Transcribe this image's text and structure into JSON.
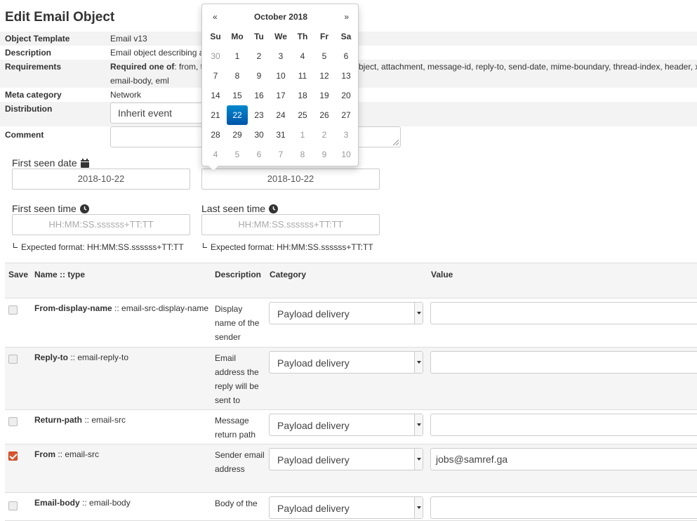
{
  "page": {
    "title": "Edit Email Object"
  },
  "info": {
    "template_label": "Object Template",
    "template_value": "Email v13",
    "description_label": "Description",
    "description_value": "Email object describing a",
    "requirements_label": "Requirements",
    "requirements_prefix": "Required one of",
    "requirements_value_part1": ": from, t",
    "requirements_value_part2": "bject, attachment, message-id, reply-to, send-date, mime-boundary, thread-index, header, x",
    "requirements_value_part3": "email-body, eml",
    "meta_label": "Meta category",
    "meta_value": "Network",
    "distribution_label": "Distribution",
    "distribution_value": "Inherit event",
    "comment_label": "Comment"
  },
  "dates": {
    "first_seen_date_label": "First seen date",
    "first_seen_date_value": "2018-10-22",
    "last_seen_date_value": "2018-10-22",
    "first_seen_time_label": "First seen time",
    "last_seen_time_label": "Last seen time",
    "time_placeholder": "HH:MM:SS.ssssss+TT:TT",
    "hint": "Expected format: HH:MM:SS.ssssss+TT:TT"
  },
  "datepicker": {
    "prev": "«",
    "next": "»",
    "title": "October 2018",
    "days_of_week": [
      "Su",
      "Mo",
      "Tu",
      "We",
      "Th",
      "Fr",
      "Sa"
    ],
    "weeks": [
      [
        "30",
        "1",
        "2",
        "3",
        "4",
        "5",
        "6"
      ],
      [
        "7",
        "8",
        "9",
        "10",
        "11",
        "12",
        "13"
      ],
      [
        "14",
        "15",
        "16",
        "17",
        "18",
        "19",
        "20"
      ],
      [
        "21",
        "22",
        "23",
        "24",
        "25",
        "26",
        "27"
      ],
      [
        "28",
        "29",
        "30",
        "31",
        "1",
        "2",
        "3"
      ],
      [
        "4",
        "5",
        "6",
        "7",
        "8",
        "9",
        "10"
      ]
    ],
    "selected": "22",
    "accent_color": "#0066bb"
  },
  "table": {
    "headers": {
      "save": "Save",
      "name": "Name :: type",
      "description": "Description",
      "category": "Category",
      "value": "Value"
    },
    "rows": [
      {
        "name": "From-display-name",
        "type": " :: email-src-display-name",
        "desc": "Display name of the sender",
        "category": "Payload delivery",
        "value": "",
        "checked": false
      },
      {
        "name": "Reply-to",
        "type": " :: email-reply-to",
        "desc": "Email address the reply will be sent to",
        "category": "Payload delivery",
        "value": "",
        "checked": false
      },
      {
        "name": "Return-path",
        "type": " :: email-src",
        "desc": "Message return path",
        "category": "Payload delivery",
        "value": "",
        "checked": false
      },
      {
        "name": "From",
        "type": " :: email-src",
        "desc": "Sender email address",
        "category": "Payload delivery",
        "value": "jobs@samref.ga",
        "checked": true
      },
      {
        "name": "Email-body",
        "type": " :: email-body",
        "desc": "Body of the",
        "category": "Payload delivery",
        "value": "",
        "checked": false
      }
    ]
  },
  "colors": {
    "checkbox_checked": "#d9552f",
    "header_bg": "#f5f5f5"
  }
}
